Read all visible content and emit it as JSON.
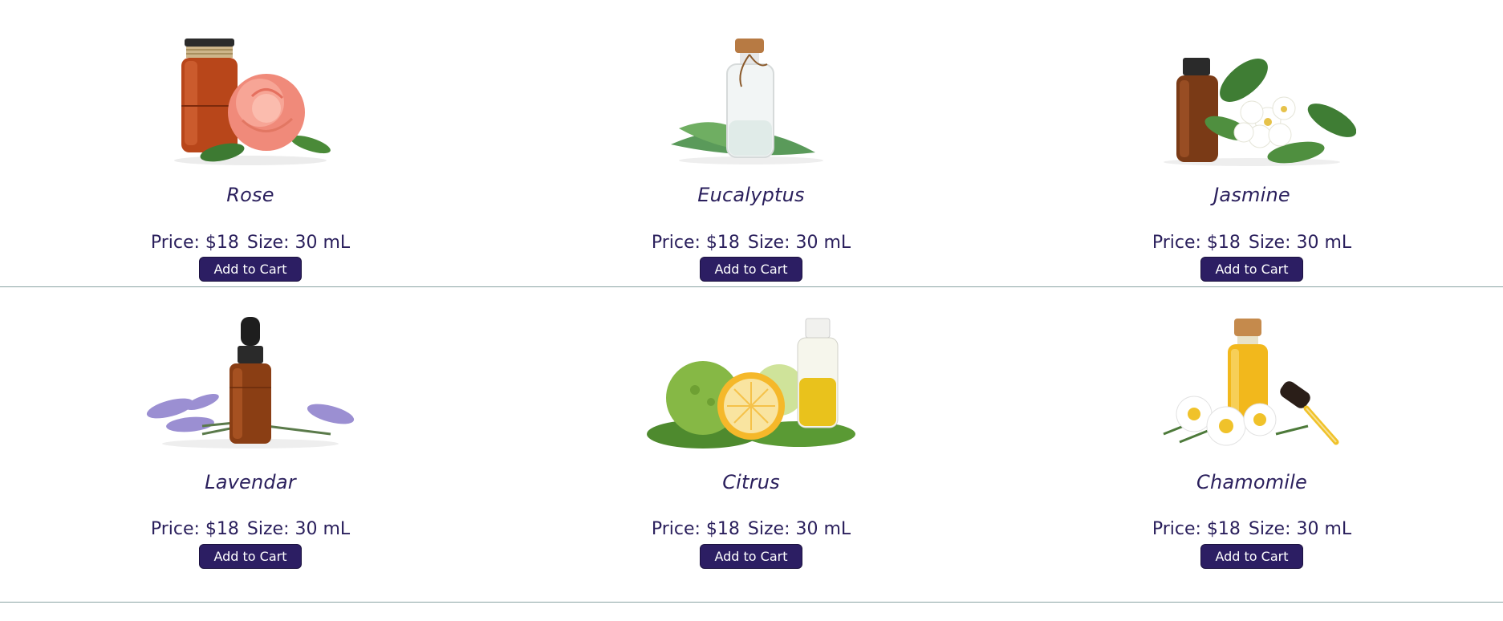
{
  "colors": {
    "text": "#2a1f5c",
    "button_bg": "#2c1e63",
    "button_text": "#ffffff",
    "divider": "#8aa3a3"
  },
  "products": [
    {
      "name": "Rose",
      "price_label": "Price: $18",
      "size_label": "Size: 30 mL",
      "button_label": "Add to Cart",
      "image_icon": "rose-oil-bottle-icon"
    },
    {
      "name": "Eucalyptus",
      "price_label": "Price: $18",
      "size_label": "Size: 30 mL",
      "button_label": "Add to Cart",
      "image_icon": "eucalyptus-oil-bottle-icon"
    },
    {
      "name": "Jasmine",
      "price_label": "Price: $18",
      "size_label": "Size: 30 mL",
      "button_label": "Add to Cart",
      "image_icon": "jasmine-oil-bottle-icon"
    },
    {
      "name": "Lavendar",
      "price_label": "Price: $18",
      "size_label": "Size: 30 mL",
      "button_label": "Add to Cart",
      "image_icon": "lavender-oil-bottle-icon"
    },
    {
      "name": "Citrus",
      "price_label": "Price: $18",
      "size_label": "Size: 30 mL",
      "button_label": "Add to Cart",
      "image_icon": "citrus-oil-bottle-icon"
    },
    {
      "name": "Chamomile",
      "price_label": "Price: $18",
      "size_label": "Size: 30 mL",
      "button_label": "Add to Cart",
      "image_icon": "chamomile-oil-bottle-icon"
    }
  ]
}
